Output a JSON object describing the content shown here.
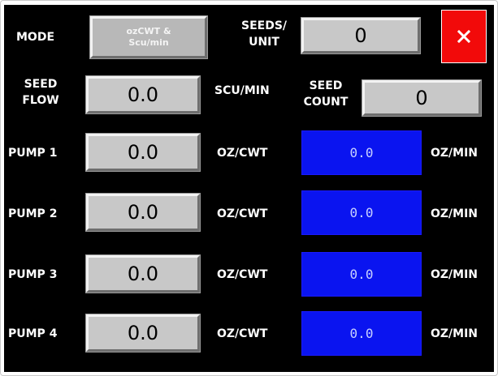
{
  "mode": {
    "label": "MODE",
    "button_line1": "ozCWT &",
    "button_line2": "Scu/min"
  },
  "seeds_per_unit": {
    "label_line1": "SEEDS/",
    "label_line2": "UNIT",
    "value": "0"
  },
  "close": {
    "icon": "close-icon",
    "color": "#f20a0a"
  },
  "seed_flow": {
    "label_line1": "SEED",
    "label_line2": "FLOW",
    "value": "0.0",
    "unit": "SCU/MIN"
  },
  "seed_count": {
    "label_line1": "SEED",
    "label_line2": "COUNT",
    "value": "0"
  },
  "pumps": [
    {
      "label": "PUMP 1",
      "rate_value": "0.0",
      "rate_unit": "OZ/CWT",
      "flow_value": "0.0",
      "flow_unit": "OZ/MIN"
    },
    {
      "label": "PUMP 2",
      "rate_value": "0.0",
      "rate_unit": "OZ/CWT",
      "flow_value": "0.0",
      "flow_unit": "OZ/MIN"
    },
    {
      "label": "PUMP 3",
      "rate_value": "0.0",
      "rate_unit": "OZ/CWT",
      "flow_value": "0.0",
      "flow_unit": "OZ/MIN"
    },
    {
      "label": "PUMP 4",
      "rate_value": "0.0",
      "rate_unit": "OZ/CWT",
      "flow_value": "0.0",
      "flow_unit": "OZ/MIN"
    }
  ],
  "colors": {
    "background": "#000000",
    "display_blue": "#0a14f0",
    "button_gray": "#c8c8c8",
    "close_red": "#f20a0a"
  }
}
